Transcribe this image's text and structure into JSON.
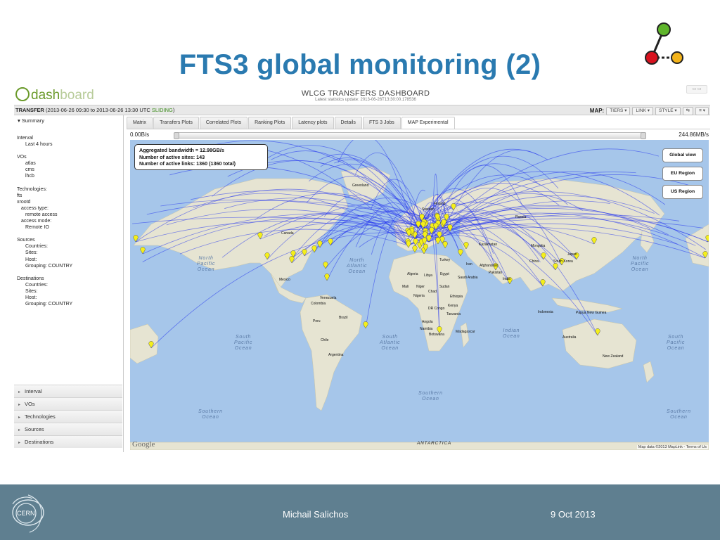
{
  "slide": {
    "title": "FTS3 global monitoring (2)",
    "footer_author": "Michail Salichos",
    "footer_date": "9 Oct 2013",
    "cern_logo_text": "CERN"
  },
  "dashboard": {
    "logo_part1": "dash",
    "logo_part2": "board",
    "title": "WLCG TRANSFERS DASHBOARD",
    "subtitle": "Latest statistics update: 2013-06-26T13:30:00.178536",
    "transfer_label": "TRANSFER",
    "transfer_range": "(2013-06-26 09:30 to 2013-06-26 13:30 UTC ",
    "transfer_sliding": "SLIDING",
    "transfer_close": ")",
    "map_label": "MAP:",
    "map_controls": [
      "TIERS",
      "LINK",
      "STYLE"
    ]
  },
  "left_panel": {
    "summary_label": "Summary",
    "interval_heading": "Interval",
    "interval_value": "Last 4 hours",
    "vos_heading": "VOs",
    "vos": [
      "atlas",
      "cms",
      "lhcb"
    ],
    "technologies_heading": "Technologies:",
    "tech_fts": "fts",
    "tech_xrootd": "xrootd",
    "access_type_label": "access type:",
    "access_type_value": "remote access",
    "access_mode_label": "access mode:",
    "access_mode_value": "Remote IO",
    "sources_heading": "Sources",
    "sources": {
      "countries": "Countries:",
      "sites": "Sites:",
      "host": "Host:",
      "grouping": "Grouping: COUNTRY"
    },
    "destinations_heading": "Destinations",
    "destinations": {
      "countries": "Countries:",
      "sites": "Sites:",
      "host": "Host:",
      "grouping": "Grouping: COUNTRY"
    },
    "accordion": [
      "Interval",
      "VOs",
      "Technologies",
      "Sources",
      "Destinations"
    ]
  },
  "tabs": [
    "Matrix",
    "Transfers Plots",
    "Correlated Plots",
    "Ranking Plots",
    "Latency plots",
    "Details",
    "FTS 3 Jobs",
    "MAP Experimental"
  ],
  "active_tab": "MAP Experimental",
  "range": {
    "min": "0.00B/s",
    "max": "244.86MB/s"
  },
  "map": {
    "stats": {
      "bandwidth": "Aggregated bandwidth = 12.98GB/s",
      "active_sites": "Number of active sites: 143",
      "active_links": "Number of active links: 1360 (1360 total)"
    },
    "buttons": [
      "Global view",
      "EU Region",
      "US Region"
    ],
    "google_label": "Google",
    "attribution": "Map data ©2013 MapLink - Terms of Us",
    "oceans": [
      "North\nPacific\nOcean",
      "North\nAtlantic\nOcean",
      "South\nPacific\nOcean",
      "South\nAtlantic\nOcean",
      "Indian\nOcean",
      "North\nPacific\nOcean",
      "South\nPacific\nOcean",
      "Southern\nOcean",
      "Southern\nOcean",
      "Southern\nOcean",
      "ANTARCTICA"
    ],
    "place_labels": [
      "Greenland",
      "Finland",
      "Sweden",
      "Russia",
      "Kazakhstan",
      "Mongolia",
      "China",
      "Japan",
      "South Korea",
      "Afghanistan",
      "Pakistan",
      "India",
      "Mexico",
      "Venezuela",
      "Colombia",
      "Peru",
      "Brazil",
      "Chile",
      "Argentina",
      "Algeria",
      "Libya",
      "Egypt",
      "Mali",
      "Niger",
      "Sudan",
      "Chad",
      "Nigeria",
      "DR Congo",
      "Kenya",
      "Tanzania",
      "Angola",
      "Namibia",
      "Botswana",
      "Madagascar",
      "Ethiopia",
      "Saudi Arabia",
      "Iran",
      "Turkey",
      "Indonesia",
      "Papua New Guinea",
      "Australia",
      "New Zealand",
      "Canada"
    ],
    "colors": {
      "link": "#2233ee",
      "marker": "#f4ef1a",
      "land": "#e8e6d4",
      "water": "#a6c6ea"
    }
  }
}
